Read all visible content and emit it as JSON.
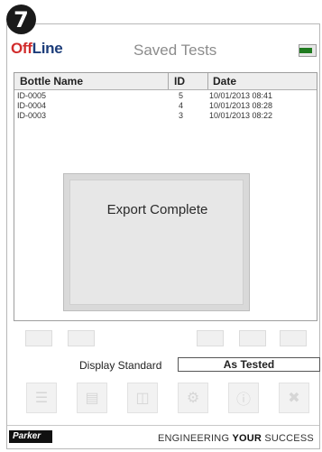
{
  "step_badge": "7",
  "header": {
    "logo_off": "Off",
    "logo_line": "Line",
    "title": "Saved Tests",
    "battery_icon": "battery-icon"
  },
  "table": {
    "columns": [
      "Bottle Name",
      "ID",
      "Date"
    ],
    "rows": [
      {
        "name": "ID-0005",
        "id": "5",
        "date": "10/01/2013 08:41"
      },
      {
        "name": "ID-0004",
        "id": "4",
        "date": "10/01/2013 08:28"
      },
      {
        "name": "ID-0003",
        "id": "3",
        "date": "10/01/2013 08:22"
      }
    ]
  },
  "dialog": {
    "message": "Export Complete"
  },
  "display_standard": {
    "label": "Display Standard",
    "value": "As Tested"
  },
  "footer": {
    "brand": "Parker",
    "tagline_prefix": "ENGINEERING ",
    "tagline_bold": "YOUR",
    "tagline_suffix": " SUCCESS"
  },
  "colors": {
    "logo_red": "#d12c2c",
    "logo_blue": "#1c3d7a",
    "battery_green": "#1f7a1f"
  }
}
